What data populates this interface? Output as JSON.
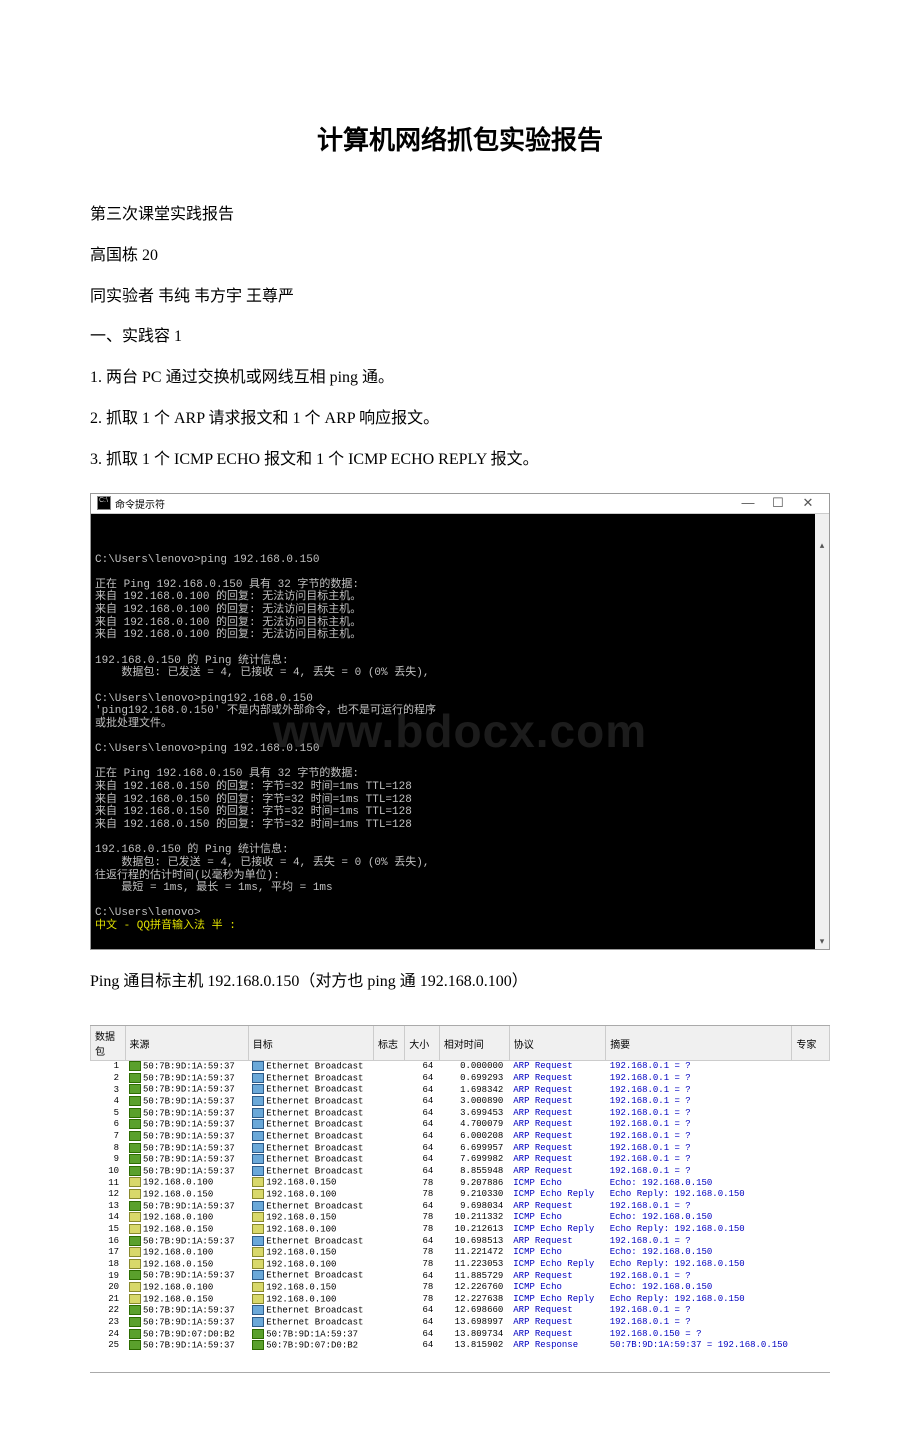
{
  "title": "计算机网络抓包实验报告",
  "p1": "第三次课堂实践报告",
  "p2": "高国栋 20",
  "p3": "同实验者 韦纯 韦方宇 王尊严",
  "p4": "一、实践容 1",
  "p5": "1. 两台 PC 通过交换机或网线互相 ping 通。",
  "p6": "2. 抓取 1 个 ARP 请求报文和 1 个 ARP 响应报文。",
  "p7": "3. 抓取 1 个 ICMP ECHO 报文和 1 个 ICMP ECHO REPLY 报文。",
  "cmd": {
    "title": "命令提示符",
    "btn_min": "—",
    "btn_max": "☐",
    "btn_close": "✕",
    "watermark": "www.bdocx.com",
    "lines": [
      "C:\\Users\\lenovo>ping 192.168.0.150",
      "",
      "正在 Ping 192.168.0.150 具有 32 字节的数据:",
      "来自 192.168.0.100 的回复: 无法访问目标主机。",
      "来自 192.168.0.100 的回复: 无法访问目标主机。",
      "来自 192.168.0.100 的回复: 无法访问目标主机。",
      "来自 192.168.0.100 的回复: 无法访问目标主机。",
      "",
      "192.168.0.150 的 Ping 统计信息:",
      "    数据包: 已发送 = 4, 已接收 = 4, 丢失 = 0 (0% 丢失),",
      "",
      "C:\\Users\\lenovo>ping192.168.0.150",
      "'ping192.168.0.150' 不是内部或外部命令，也不是可运行的程序",
      "或批处理文件。",
      "",
      "C:\\Users\\lenovo>ping 192.168.0.150",
      "",
      "正在 Ping 192.168.0.150 具有 32 字节的数据:",
      "来自 192.168.0.150 的回复: 字节=32 时间=1ms TTL=128",
      "来自 192.168.0.150 的回复: 字节=32 时间=1ms TTL=128",
      "来自 192.168.0.150 的回复: 字节=32 时间=1ms TTL=128",
      "来自 192.168.0.150 的回复: 字节=32 时间=1ms TTL=128",
      "",
      "192.168.0.150 的 Ping 统计信息:",
      "    数据包: 已发送 = 4, 已接收 = 4, 丢失 = 0 (0% 丢失),",
      "往返行程的估计时间(以毫秒为单位):",
      "    最短 = 1ms, 最长 = 1ms, 平均 = 1ms",
      "",
      "C:\\Users\\lenovo>"
    ],
    "yellow": "中文 - QQ拼音输入法 半 :"
  },
  "caption": "Ping 通目标主机 192.168.0.150（对方也 ping 通 192.168.0.100）",
  "table": {
    "headers": [
      "数据包",
      "来源",
      "目标",
      "标志",
      "大小",
      "相对时间",
      "协议",
      "摘要",
      "专家"
    ],
    "rows": [
      {
        "n": "1",
        "src": "50:7B:9D:1A:59:37",
        "sc": "c1",
        "dst": "Ethernet Broadcast",
        "dc": "c2",
        "sz": "64",
        "t": "0.000000",
        "p": "ARP Request",
        "sm": "192.168.0.1 = ?"
      },
      {
        "n": "2",
        "src": "50:7B:9D:1A:59:37",
        "sc": "c1",
        "dst": "Ethernet Broadcast",
        "dc": "c2",
        "sz": "64",
        "t": "0.699293",
        "p": "ARP Request",
        "sm": "192.168.0.1 = ?"
      },
      {
        "n": "3",
        "src": "50:7B:9D:1A:59:37",
        "sc": "c1",
        "dst": "Ethernet Broadcast",
        "dc": "c2",
        "sz": "64",
        "t": "1.698342",
        "p": "ARP Request",
        "sm": "192.168.0.1 = ?"
      },
      {
        "n": "4",
        "src": "50:7B:9D:1A:59:37",
        "sc": "c1",
        "dst": "Ethernet Broadcast",
        "dc": "c2",
        "sz": "64",
        "t": "3.000890",
        "p": "ARP Request",
        "sm": "192.168.0.1 = ?"
      },
      {
        "n": "5",
        "src": "50:7B:9D:1A:59:37",
        "sc": "c1",
        "dst": "Ethernet Broadcast",
        "dc": "c2",
        "sz": "64",
        "t": "3.699453",
        "p": "ARP Request",
        "sm": "192.168.0.1 = ?"
      },
      {
        "n": "6",
        "src": "50:7B:9D:1A:59:37",
        "sc": "c1",
        "dst": "Ethernet Broadcast",
        "dc": "c2",
        "sz": "64",
        "t": "4.700079",
        "p": "ARP Request",
        "sm": "192.168.0.1 = ?"
      },
      {
        "n": "7",
        "src": "50:7B:9D:1A:59:37",
        "sc": "c1",
        "dst": "Ethernet Broadcast",
        "dc": "c2",
        "sz": "64",
        "t": "6.000208",
        "p": "ARP Request",
        "sm": "192.168.0.1 = ?"
      },
      {
        "n": "8",
        "src": "50:7B:9D:1A:59:37",
        "sc": "c1",
        "dst": "Ethernet Broadcast",
        "dc": "c2",
        "sz": "64",
        "t": "6.699957",
        "p": "ARP Request",
        "sm": "192.168.0.1 = ?"
      },
      {
        "n": "9",
        "src": "50:7B:9D:1A:59:37",
        "sc": "c1",
        "dst": "Ethernet Broadcast",
        "dc": "c2",
        "sz": "64",
        "t": "7.699982",
        "p": "ARP Request",
        "sm": "192.168.0.1 = ?"
      },
      {
        "n": "10",
        "src": "50:7B:9D:1A:59:37",
        "sc": "c1",
        "dst": "Ethernet Broadcast",
        "dc": "c2",
        "sz": "64",
        "t": "8.855948",
        "p": "ARP Request",
        "sm": "192.168.0.1 = ?"
      },
      {
        "n": "11",
        "src": "192.168.0.100",
        "sc": "c3",
        "dst": "192.168.0.150",
        "dc": "c3",
        "sz": "78",
        "t": "9.207886",
        "p": "ICMP Echo",
        "sm": "Echo: 192.168.0.150"
      },
      {
        "n": "12",
        "src": "192.168.0.150",
        "sc": "c3",
        "dst": "192.168.0.100",
        "dc": "c3",
        "sz": "78",
        "t": "9.210330",
        "p": "ICMP Echo Reply",
        "sm": "Echo Reply: 192.168.0.150"
      },
      {
        "n": "13",
        "src": "50:7B:9D:1A:59:37",
        "sc": "c1",
        "dst": "Ethernet Broadcast",
        "dc": "c2",
        "sz": "64",
        "t": "9.698034",
        "p": "ARP Request",
        "sm": "192.168.0.1 = ?"
      },
      {
        "n": "14",
        "src": "192.168.0.100",
        "sc": "c3",
        "dst": "192.168.0.150",
        "dc": "c3",
        "sz": "78",
        "t": "10.211332",
        "p": "ICMP Echo",
        "sm": "Echo: 192.168.0.150"
      },
      {
        "n": "15",
        "src": "192.168.0.150",
        "sc": "c3",
        "dst": "192.168.0.100",
        "dc": "c3",
        "sz": "78",
        "t": "10.212613",
        "p": "ICMP Echo Reply",
        "sm": "Echo Reply: 192.168.0.150"
      },
      {
        "n": "16",
        "src": "50:7B:9D:1A:59:37",
        "sc": "c1",
        "dst": "Ethernet Broadcast",
        "dc": "c2",
        "sz": "64",
        "t": "10.698513",
        "p": "ARP Request",
        "sm": "192.168.0.1 = ?"
      },
      {
        "n": "17",
        "src": "192.168.0.100",
        "sc": "c3",
        "dst": "192.168.0.150",
        "dc": "c3",
        "sz": "78",
        "t": "11.221472",
        "p": "ICMP Echo",
        "sm": "Echo: 192.168.0.150"
      },
      {
        "n": "18",
        "src": "192.168.0.150",
        "sc": "c3",
        "dst": "192.168.0.100",
        "dc": "c3",
        "sz": "78",
        "t": "11.223053",
        "p": "ICMP Echo Reply",
        "sm": "Echo Reply: 192.168.0.150"
      },
      {
        "n": "19",
        "src": "50:7B:9D:1A:59:37",
        "sc": "c1",
        "dst": "Ethernet Broadcast",
        "dc": "c2",
        "sz": "64",
        "t": "11.885729",
        "p": "ARP Request",
        "sm": "192.168.0.1 = ?"
      },
      {
        "n": "20",
        "src": "192.168.0.100",
        "sc": "c3",
        "dst": "192.168.0.150",
        "dc": "c3",
        "sz": "78",
        "t": "12.226760",
        "p": "ICMP Echo",
        "sm": "Echo: 192.168.0.150"
      },
      {
        "n": "21",
        "src": "192.168.0.150",
        "sc": "c3",
        "dst": "192.168.0.100",
        "dc": "c3",
        "sz": "78",
        "t": "12.227638",
        "p": "ICMP Echo Reply",
        "sm": "Echo Reply: 192.168.0.150"
      },
      {
        "n": "22",
        "src": "50:7B:9D:1A:59:37",
        "sc": "c1",
        "dst": "Ethernet Broadcast",
        "dc": "c2",
        "sz": "64",
        "t": "12.698660",
        "p": "ARP Request",
        "sm": "192.168.0.1 = ?"
      },
      {
        "n": "23",
        "src": "50:7B:9D:1A:59:37",
        "sc": "c1",
        "dst": "Ethernet Broadcast",
        "dc": "c2",
        "sz": "64",
        "t": "13.698997",
        "p": "ARP Request",
        "sm": "192.168.0.1 = ?"
      },
      {
        "n": "24",
        "src": "50:7B:9D:07:D0:B2",
        "sc": "c1",
        "dst": "50:7B:9D:1A:59:37",
        "dc": "c1",
        "sz": "64",
        "t": "13.809734",
        "p": "ARP Request",
        "sm": "192.168.0.150 = ?"
      },
      {
        "n": "25",
        "src": "50:7B:9D:1A:59:37",
        "sc": "c1",
        "dst": "50:7B:9D:07:D0:B2",
        "dc": "c1",
        "sz": "64",
        "t": "13.815902",
        "p": "ARP Response",
        "sm": "50:7B:9D:1A:59:37 = 192.168.0.150"
      }
    ]
  }
}
